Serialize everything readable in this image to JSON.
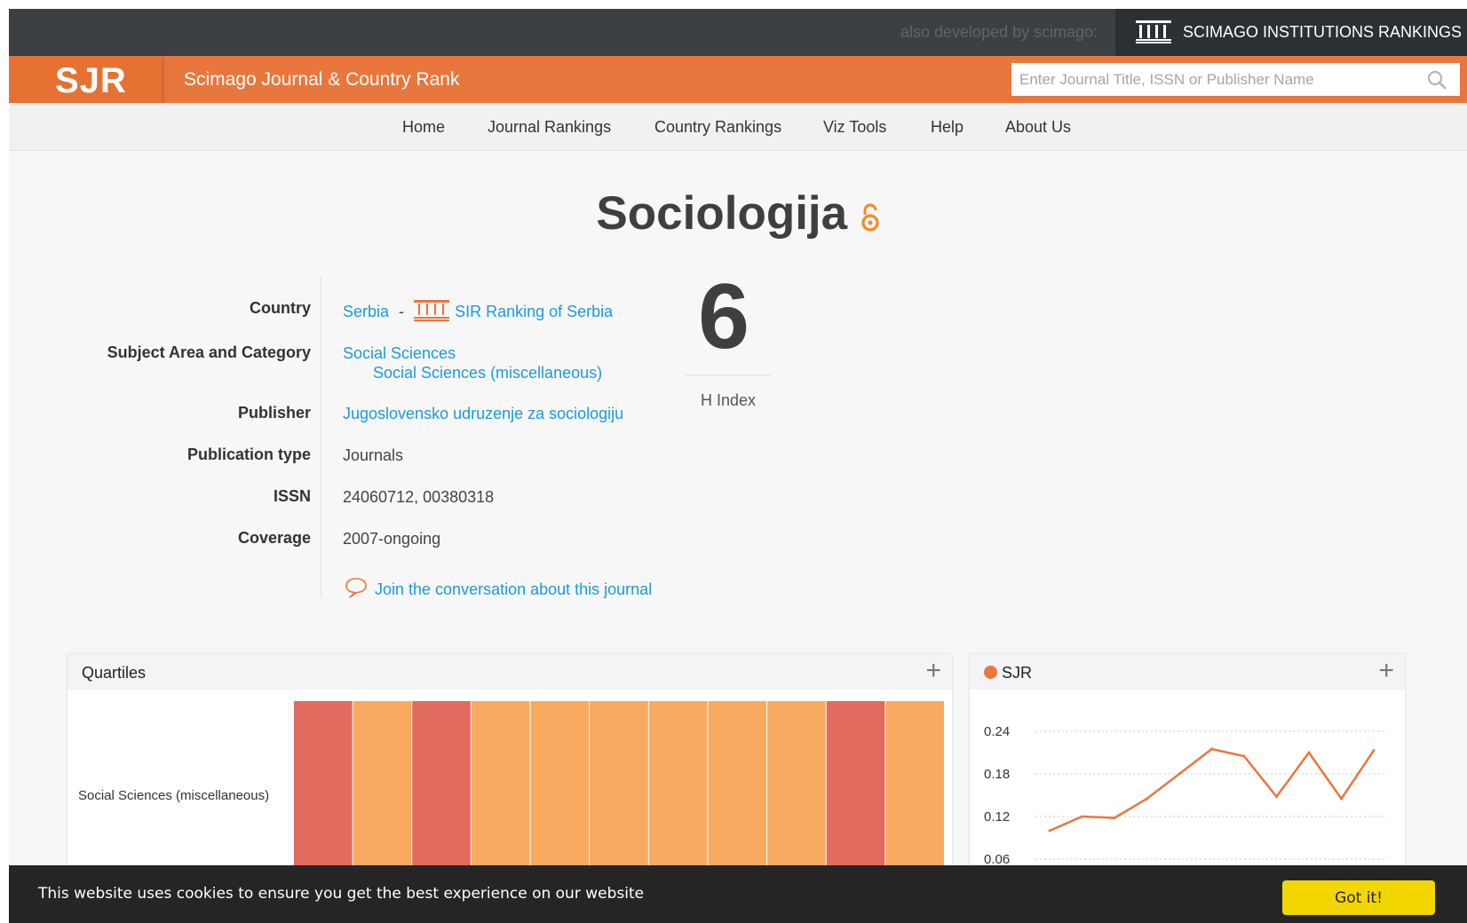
{
  "topbar": {
    "also_developed": "also developed by scimago:",
    "sir_label": "SCIMAGO INSTITUTIONS RANKINGS"
  },
  "header": {
    "logo": "SJR",
    "site_name": "Scimago Journal & Country Rank",
    "search_placeholder": "Enter Journal Title, ISSN or Publisher Name"
  },
  "nav": {
    "items": [
      "Home",
      "Journal Rankings",
      "Country Rankings",
      "Viz Tools",
      "Help",
      "About Us"
    ]
  },
  "journal": {
    "title": "Sociologija",
    "labels": {
      "country": "Country",
      "subject": "Subject Area and Category",
      "publisher": "Publisher",
      "pubtype": "Publication type",
      "issn": "ISSN",
      "coverage": "Coverage"
    },
    "country": "Serbia",
    "country_sep": "-",
    "sir_link": "SIR Ranking of Serbia",
    "subject_area": "Social Sciences",
    "subject_category": "Social Sciences (miscellaneous)",
    "publisher": "Jugoslovensko udruzenje za sociologiju",
    "publication_type": "Journals",
    "issn": "24060712, 00380318",
    "coverage": "2007-ongoing",
    "conversation": "Join the conversation about this journal",
    "h_index": "6",
    "h_index_label": "H Index"
  },
  "quartiles_widget": {
    "title": "Quartiles",
    "plus": "+",
    "category": "Social Sciences (miscellaneous)"
  },
  "sjr_widget": {
    "title": "SJR",
    "plus": "+"
  },
  "colors": {
    "brand_orange": "#e8773d",
    "q3": "#f8ab60",
    "q4": "#e06b5e",
    "link": "#1e9ad6"
  },
  "chart_data": [
    {
      "type": "heatmap",
      "title": "Quartiles",
      "categories": [
        "Social Sciences (miscellaneous)"
      ],
      "quartiles": [
        "Q4",
        "Q3",
        "Q4",
        "Q3",
        "Q3",
        "Q3",
        "Q3",
        "Q3",
        "Q3",
        "Q4",
        "Q3"
      ]
    },
    {
      "type": "line",
      "title": "SJR",
      "series": [
        {
          "name": "SJR",
          "values": [
            0.1,
            0.12,
            0.118,
            0.145,
            0.18,
            0.215,
            0.205,
            0.148,
            0.21,
            0.145,
            0.213
          ]
        }
      ],
      "y_ticks": [
        "0.24",
        "0.18",
        "0.12",
        "0.06"
      ],
      "ylim": [
        0.06,
        0.24
      ],
      "grid": true
    }
  ]
}
